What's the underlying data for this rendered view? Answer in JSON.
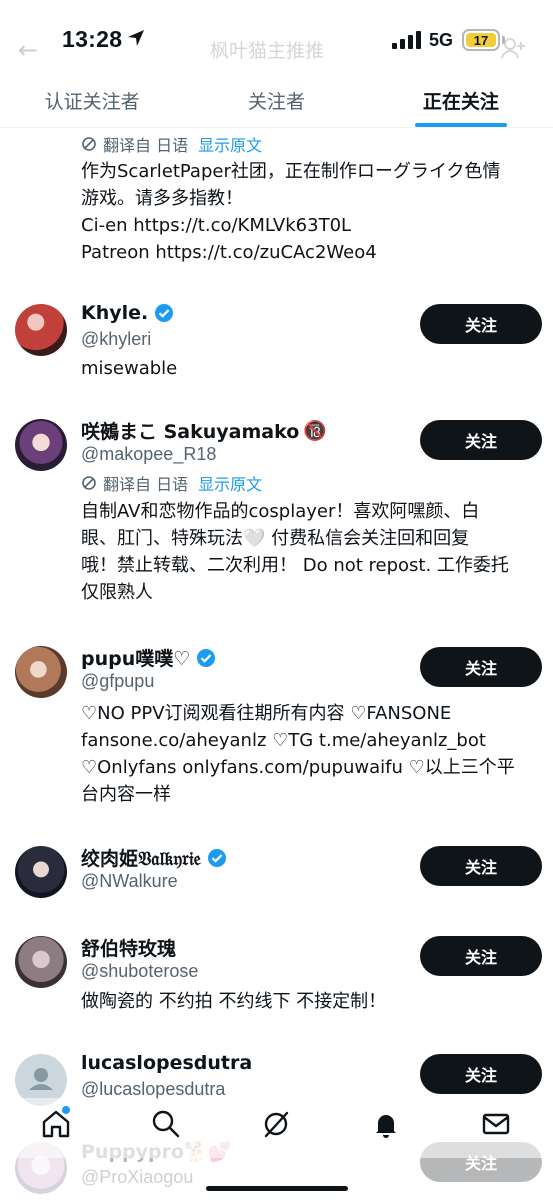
{
  "status_bar": {
    "time": "13:28",
    "network": "5G",
    "battery": "17",
    "faded_title": "枫叶猫主推推"
  },
  "tabs": [
    {
      "label": "认证关注者",
      "active": false
    },
    {
      "label": "关注者",
      "active": false
    },
    {
      "label": "正在关注",
      "active": true
    }
  ],
  "items": [
    {
      "translate_label": "翻译自 日语",
      "show_original": "显示原文",
      "bio_lines": [
        "作为ScarletPaper社团，正在制作ローグライク色情",
        "游戏。请多多指教！",
        "Ci-en https://t.co/KMLVk63T0L",
        "Patreon https://t.co/zuCAc2Weo4"
      ]
    },
    {
      "name": "Khyle.",
      "verified": true,
      "handle": "@khyleri",
      "follow_label": "关注",
      "bio_lines": [
        "misewable"
      ]
    },
    {
      "name": "咲鵺まこ Sakuyamako",
      "badge": "🔞",
      "handle": "@makopee_R18",
      "translate_label": "翻译自 日语",
      "show_original": "显示原文",
      "follow_label": "关注",
      "bio_lines": [
        "自制AV和恋物作品的cosplayer！喜欢阿嘿颜、白",
        "眼、肛门、特殊玩法🤍 付费私信会关注回和回复",
        "哦！禁止转载、二次利用！ Do not repost. 工作委托",
        "仅限熟人"
      ]
    },
    {
      "name": "pupu噗噗♡",
      "verified": true,
      "handle": "@gfpupu",
      "follow_label": "关注",
      "bio_lines": [
        "♡NO PPV订阅观看往期所有内容 ♡FANSONE",
        "fansone.co/aheyanlz ♡TG t.me/aheyanlz_bot",
        "♡Onlyfans onlyfans.com/pupuwaifu ♡以上三个平",
        "台内容一样"
      ]
    },
    {
      "name": "绞肉姫𝔙𝔞𝔩𝔨𝔶𝔯𝔦𝔢",
      "verified": true,
      "handle": "@NWalkure",
      "follow_label": "关注",
      "bio_lines": []
    },
    {
      "name": "舒伯特玫瑰",
      "handle": "@shuboterose",
      "follow_label": "关注",
      "bio_lines": [
        "做陶瓷的 不约拍 不约线下 不接定制！"
      ]
    },
    {
      "name": "lucaslopesdutra",
      "handle": "@lucaslopesdutra",
      "follow_label": "关注",
      "bio_lines": []
    },
    {
      "name": "Puppypro🐕💕",
      "handle": "@ProXiaogou",
      "follow_label": "关注",
      "bio_lines": []
    }
  ],
  "colors": {
    "accent": "#1d9bf0",
    "text": "#0f1419",
    "secondary": "#536471",
    "button": "#0f1419"
  },
  "nav_icons": [
    "home-icon",
    "search-icon",
    "grok-icon",
    "notifications-icon",
    "messages-icon"
  ]
}
